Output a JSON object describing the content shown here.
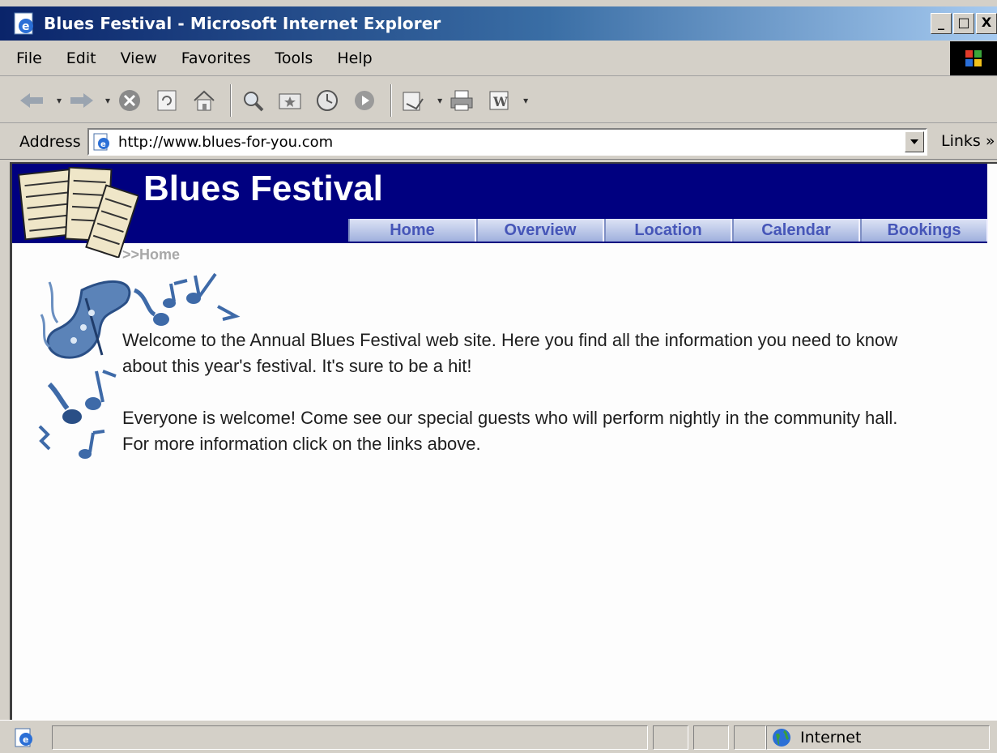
{
  "window": {
    "title": "Blues Festival - Microsoft Internet Explorer",
    "minimize": "_",
    "maximize": "□",
    "close": "X"
  },
  "menu": {
    "items": [
      "File",
      "Edit",
      "View",
      "Favorites",
      "Tools",
      "Help"
    ]
  },
  "toolbar": {
    "icons": [
      "back-icon",
      "forward-icon",
      "stop-icon",
      "refresh-icon",
      "home-icon",
      "search-icon",
      "favorites-icon",
      "history-icon",
      "media-icon",
      "mail-icon",
      "print-icon",
      "word-icon"
    ]
  },
  "address": {
    "label": "Address",
    "url": "http://www.blues-for-you.com",
    "links_label": "Links »"
  },
  "site": {
    "title": "Blues Festival",
    "nav": [
      "Home",
      "Overview",
      "Location",
      "Calendar",
      "Bookings"
    ],
    "breadcrumb": ">>Home",
    "paragraph1": "Welcome to the Annual Blues Festival web site.  Here you find all the information you need to know about this year's festival. It's sure to be a hit!",
    "paragraph2": "Everyone is welcome! Come see our special guests who will perform nightly in the community hall. For more information click on the links above."
  },
  "status": {
    "zone": "Internet"
  },
  "colors": {
    "banner": "#000080",
    "nav_text": "#4656b8",
    "title_bar_start": "#0a246a"
  }
}
